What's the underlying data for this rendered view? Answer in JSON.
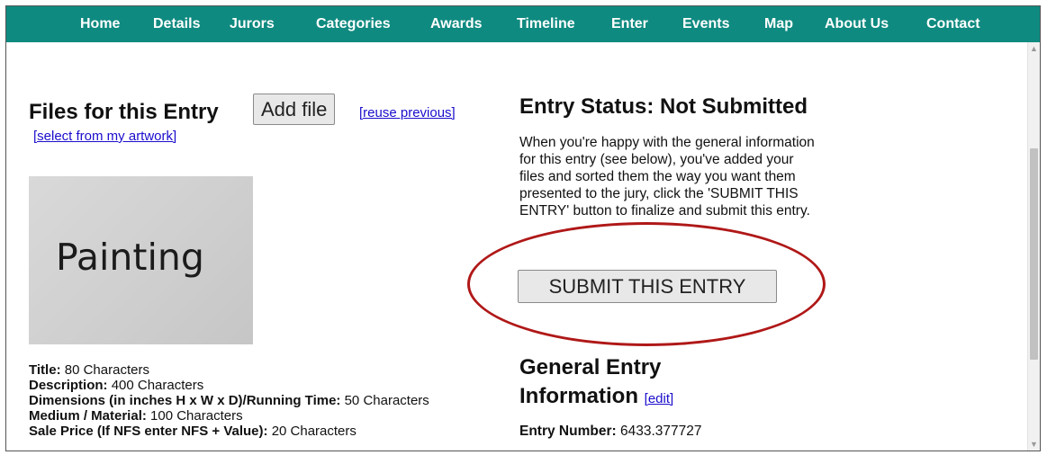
{
  "nav": {
    "items": [
      "Home",
      "Details",
      "Jurors",
      "Categories",
      "Awards",
      "Timeline",
      "Enter",
      "Events",
      "Map",
      "About Us",
      "Contact"
    ]
  },
  "files": {
    "heading": "Files for this Entry",
    "add_button": "Add file",
    "reuse_link": "[reuse previous]",
    "select_link": "[select from my artwork]",
    "thumbnail_text": "Painting"
  },
  "fields": [
    {
      "label": "Title:",
      "value": "80 Characters"
    },
    {
      "label": "Description:",
      "value": "400 Characters"
    },
    {
      "label": "Dimensions (in inches H x W x D)/Running Time:",
      "value": "50 Characters"
    },
    {
      "label": "Medium / Material:",
      "value": "100 Characters"
    },
    {
      "label": "Sale Price (If NFS enter NFS + Value):",
      "value": "20 Characters"
    }
  ],
  "status": {
    "heading": "Entry Status: Not Submitted",
    "description": "When you're happy with the general information for this entry (see below), you've added your files and sorted them the way you want them presented to the jury, click the 'SUBMIT THIS ENTRY' button to finalize and submit this entry.",
    "submit_button": "SUBMIT THIS ENTRY",
    "annotation_color": "#b01818"
  },
  "general": {
    "heading": "General Entry Information",
    "edit_link": "[edit]",
    "entry_number_label": "Entry Number:",
    "entry_number_value": "6433.377727"
  },
  "colors": {
    "nav_bg": "#0f8a80",
    "link": "#1a0dcc"
  }
}
